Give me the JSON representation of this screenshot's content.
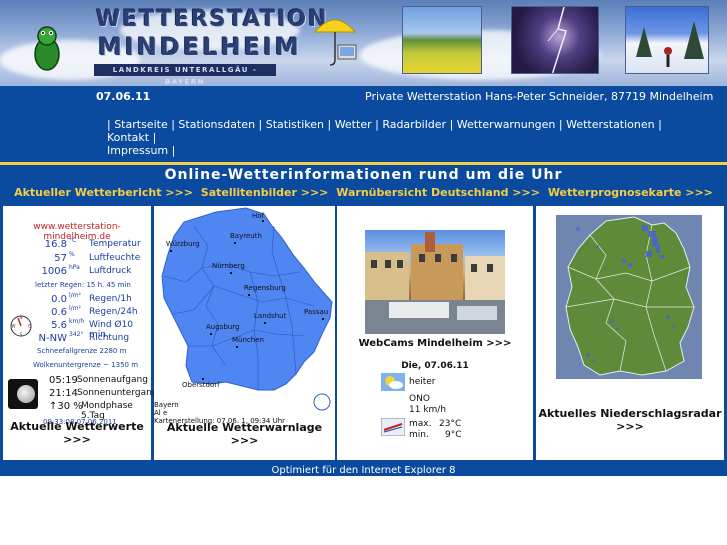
{
  "header": {
    "title_line1": "WETTERSTATION",
    "title_line2": "MINDELHEIM",
    "subtitle": "LANDKREIS UNTERALLGÄU - BAYERN"
  },
  "topbar": {
    "date": "07.06.11",
    "operator": "Private Wetterstation Hans-Peter Schneider, 87719 Mindelheim"
  },
  "nav": {
    "items": [
      "Startseite",
      "Stationsdaten",
      "Statistiken",
      "Wetter",
      "Radarbilder",
      "Wetterwarnungen",
      "Wetterstationen",
      "Kontakt",
      "Impressum"
    ]
  },
  "headline": "Online-Wetterinformationen rund um die Uhr",
  "sublinks": [
    "Aktueller Wetterbericht >>>",
    "Satellitenbilder >>>",
    "Warnübersicht Deutschland >>>",
    "Wetterprognosekarte >>>"
  ],
  "current": {
    "site": "www.wetterstation-mindelheim.de",
    "temp": {
      "value": "16.8",
      "unit": "°C",
      "label": "Temperatur"
    },
    "humidity": {
      "value": "57",
      "unit": "%",
      "label": "Luftfeuchte"
    },
    "pressure": {
      "value": "1006",
      "unit": "hPa",
      "label": "Luftdruck"
    },
    "last_rain": "letzter Regen:  15 h. 45 min",
    "rain_1h": {
      "value": "0.0",
      "unit": "l/m²",
      "label": "Regen/1h"
    },
    "rain_24h": {
      "value": "0.6",
      "unit": "l/m²",
      "label": "Regen/24h"
    },
    "wind": {
      "value": "5.6",
      "unit": "km/h",
      "label": "Wind Ø10 min."
    },
    "direction": {
      "value": "N-NW",
      "unit": "342°",
      "label": "Richtung"
    },
    "snow_limit": "Schneefallgrenze   2280 m",
    "cloud_base": "Wolkenuntergrenze   ~ 1350 m",
    "sunrise": {
      "time": "05:19",
      "label": "Sonnenaufgang"
    },
    "sunset": {
      "time": "21:14",
      "label": "Sonnenuntergang"
    },
    "moon": {
      "value": "↑30 %",
      "label": "Mondphase 5.Tag"
    },
    "timestamp": "09:33:08    07.06.2011",
    "link": "Aktuelle Wetterwerte >>>"
  },
  "warnings": {
    "cities": [
      "Hof",
      "Bayreuth",
      "Würzburg",
      "Nürnberg",
      "Regensburg",
      "Landshut",
      "Passau",
      "Augsburg",
      "München",
      "Oberstdorf"
    ],
    "caption_line1": "Bayern",
    "caption_line2": "Al e",
    "caption_line3": "Kartenerstellung: 07.06.   1, 09:34 Uhr",
    "link": "Aktuelle Wetterwarnlage >>>"
  },
  "webcam": {
    "link": "WebCams Mindelheim >>>",
    "date": "Die, 07.06.11",
    "condition": "heiter",
    "wind_dir": "ONO",
    "wind_speed": "11 km/h",
    "max_label": "max.",
    "max_value": "23°C",
    "min_label": "min.",
    "min_value": "9°C"
  },
  "radar": {
    "link": "Aktuelles Niederschlagsradar >>>"
  },
  "footer": "Optimiert für den Internet Explorer 8",
  "colors": {
    "main_blue": "#0a4ba0",
    "accent_yellow": "#f3cf45",
    "map_blue": "#4f86f2",
    "value_blue": "#1a3fa0",
    "url_red": "#c0211f"
  }
}
